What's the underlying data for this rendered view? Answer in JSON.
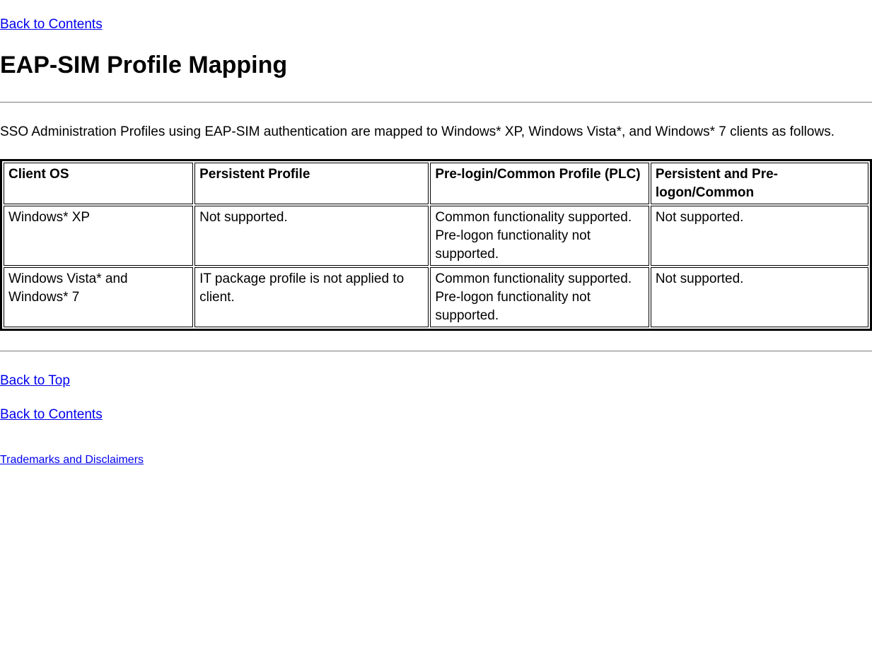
{
  "links": {
    "back_to_contents_top": "Back to Contents",
    "back_to_top": "Back to Top",
    "back_to_contents_bottom": "Back to Contents",
    "trademarks": "Trademarks and Disclaimers"
  },
  "heading": "EAP-SIM Profile Mapping",
  "intro": "SSO Administration Profiles using EAP-SIM authentication are mapped to Windows* XP, Windows Vista*, and Windows* 7 clients as follows.",
  "table": {
    "headers": {
      "col1": "Client OS",
      "col2": "Persistent Profile",
      "col3": "Pre-login/Common Profile (PLC)",
      "col4": "Persistent and Pre-logon/Common"
    },
    "rows": [
      {
        "col1": "Windows* XP",
        "col2": "Not supported.",
        "col3_line1": "Common functionality supported.",
        "col3_line2": "Pre-logon functionality not supported.",
        "col4": "Not supported."
      },
      {
        "col1": "Windows Vista* and Windows* 7",
        "col2": "IT package profile is not applied to client.",
        "col3_line1": "Common functionality supported.",
        "col3_line2": "Pre-logon functionality not supported.",
        "col4": "Not supported."
      }
    ]
  }
}
